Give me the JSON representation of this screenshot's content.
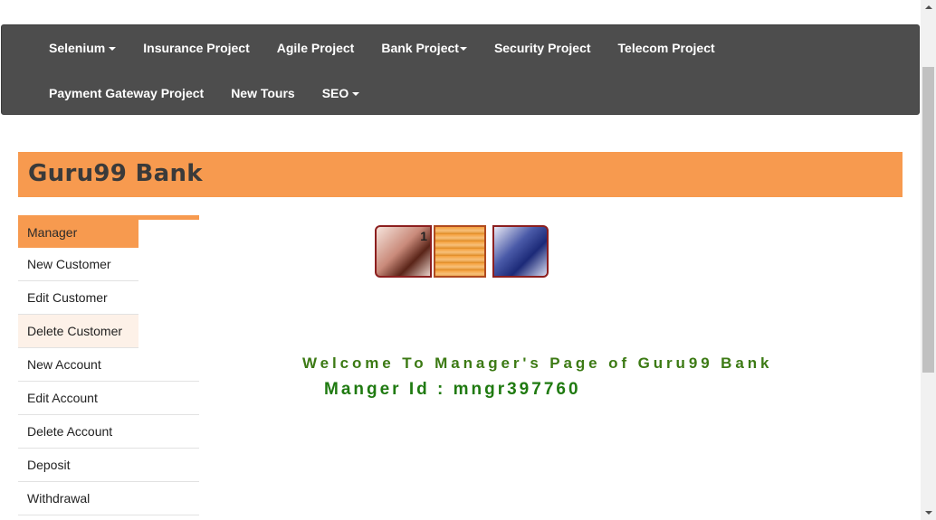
{
  "navbar": {
    "row1": [
      {
        "label": "Selenium",
        "dropdown": true
      },
      {
        "label": "Insurance Project",
        "dropdown": false
      },
      {
        "label": "Agile Project",
        "dropdown": false
      },
      {
        "label": "Bank Project",
        "dropdown": true
      },
      {
        "label": "Security Project",
        "dropdown": false
      },
      {
        "label": "Telecom Project",
        "dropdown": false
      }
    ],
    "row2": [
      {
        "label": "Payment Gateway Project",
        "dropdown": false
      },
      {
        "label": "New Tours",
        "dropdown": false
      },
      {
        "label": "SEO",
        "dropdown": true
      }
    ]
  },
  "header": {
    "title": "Guru99 Bank"
  },
  "sidebar": {
    "items": [
      {
        "label": "Manager",
        "state": "active"
      },
      {
        "label": "New Customer",
        "state": "normal"
      },
      {
        "label": "Edit Customer",
        "state": "normal"
      },
      {
        "label": "Delete Customer",
        "state": "hover"
      },
      {
        "label": "New Account",
        "state": "normal"
      },
      {
        "label": "Edit Account",
        "state": "normal"
      },
      {
        "label": "Delete Account",
        "state": "normal"
      },
      {
        "label": "Deposit",
        "state": "normal"
      },
      {
        "label": "Withdrawal",
        "state": "normal"
      }
    ]
  },
  "banner": {
    "images": [
      "banner-photo-phone-call",
      "banner-photo-coins",
      "banner-photo-workers"
    ]
  },
  "main": {
    "welcome_text": "Welcome To Manager's Page of Guru99 Bank",
    "manager_id_text": "Manger Id : mngr397760"
  },
  "colors": {
    "navbar_bg": "#4d4d4d",
    "accent": "#f79a4f",
    "welcome_text": "#3c7a14"
  }
}
